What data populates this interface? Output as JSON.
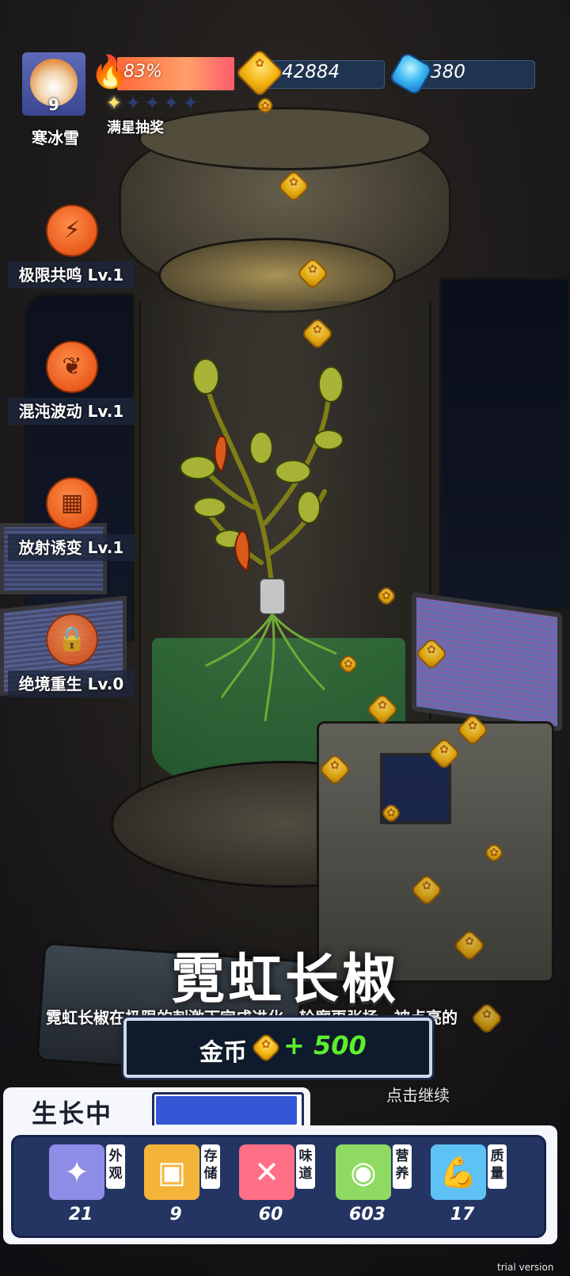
{
  "player": {
    "name": "寒冰雪",
    "level": "9"
  },
  "fire": {
    "value": "83%",
    "fill_fraction": 0.83
  },
  "stars": {
    "lit": 1,
    "total": 5,
    "label": "满星抽奖"
  },
  "resources": {
    "gold": "42884",
    "gems": "380"
  },
  "skills": [
    {
      "label": "极限共鸣 Lv.1",
      "icon": "lightning-leaf-icon"
    },
    {
      "label": "混沌波动 Lv.1",
      "icon": "plant-dome-icon"
    },
    {
      "label": "放射诱变 Lv.1",
      "icon": "boxes-leaf-icon"
    },
    {
      "label": "绝境重生 Lv.0",
      "icon": "lock-icon",
      "locked": true
    }
  ],
  "plant": {
    "name": "霓虹长椒",
    "description": "霓虹长椒在极限的刺激下完成进化，轮廓更张扬，被点亮的"
  },
  "reward": {
    "label": "金币",
    "amount": "+ 500"
  },
  "continue_text": "点击继续",
  "growth": {
    "title": "生长中",
    "progress_fraction": 0.98
  },
  "stats": [
    {
      "tag": "外观",
      "value": "21",
      "icon": "sparkle-icon",
      "color": "#8d8ce6"
    },
    {
      "tag": "存储",
      "value": "9",
      "icon": "box-icon",
      "color": "#f4b43a"
    },
    {
      "tag": "味道",
      "value": "60",
      "icon": "fork-knife-icon",
      "color": "#ff6f86"
    },
    {
      "tag": "营养",
      "value": "603",
      "icon": "fruit-icon",
      "color": "#8fda62"
    },
    {
      "tag": "质量",
      "value": "17",
      "icon": "muscle-icon",
      "color": "#5fc2f5"
    }
  ],
  "watermark": "trial version"
}
